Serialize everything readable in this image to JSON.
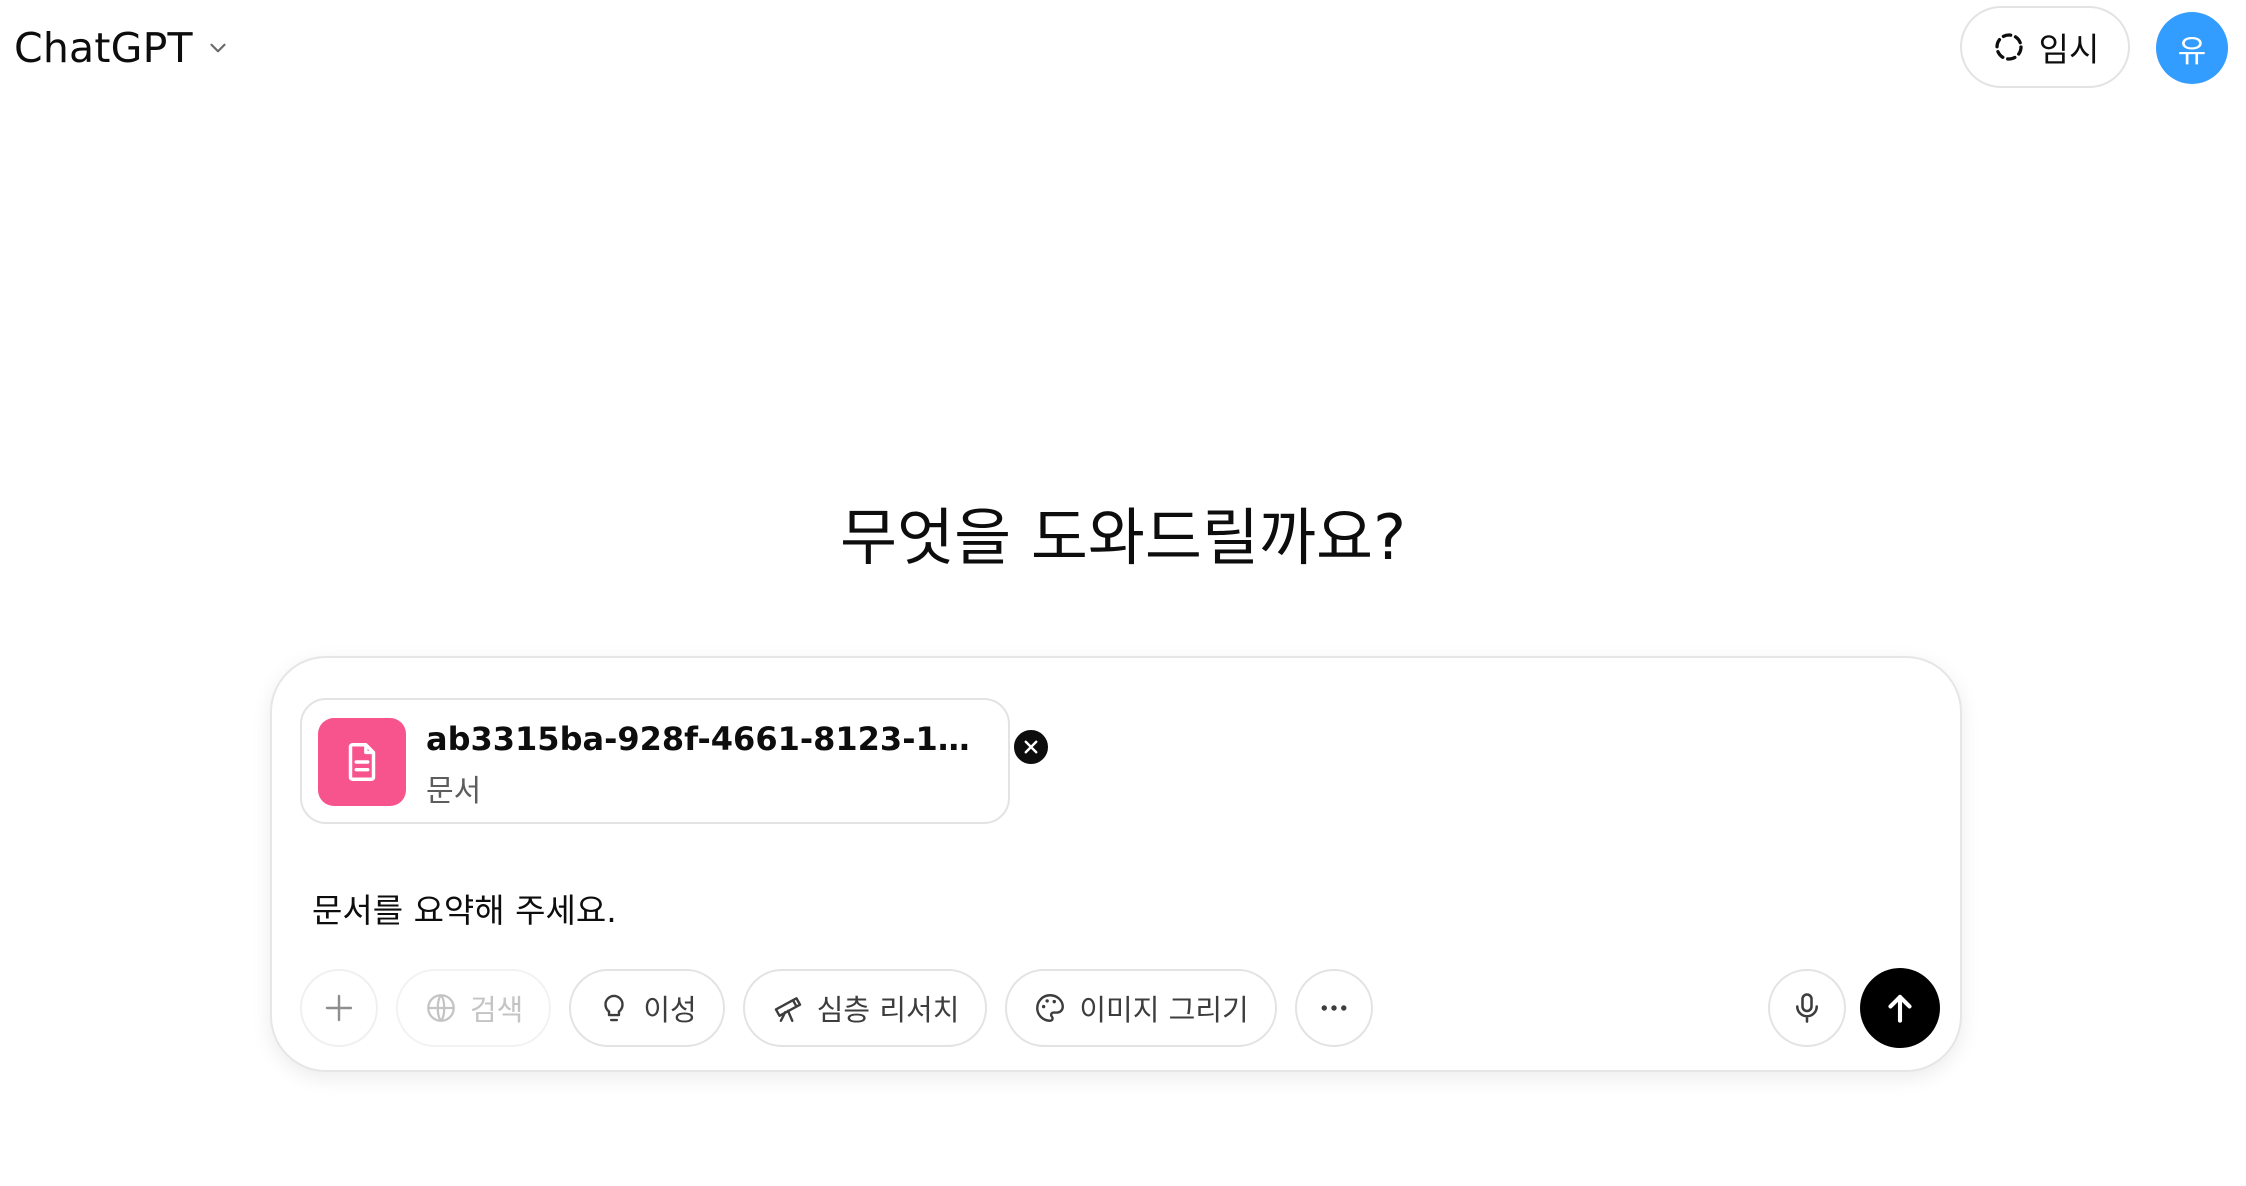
{
  "header": {
    "model_name": "ChatGPT",
    "temporary_label": "임시",
    "avatar_initial": "유"
  },
  "main": {
    "headline": "무엇을 도와드릴까요?"
  },
  "composer": {
    "attachment": {
      "file_name": "ab3315ba-928f-4661-8123-153b7...",
      "file_type": "문서",
      "icon": "document-icon"
    },
    "prompt_text": "문서를 요약해 주세요.",
    "tools": {
      "search_label": "검색",
      "reason_label": "이성",
      "deep_research_label": "심층 리서치",
      "draw_image_label": "이미지 그리기"
    }
  },
  "colors": {
    "avatar": "#339cff",
    "file_icon_bg": "#f7538c",
    "send_button": "#000000"
  }
}
